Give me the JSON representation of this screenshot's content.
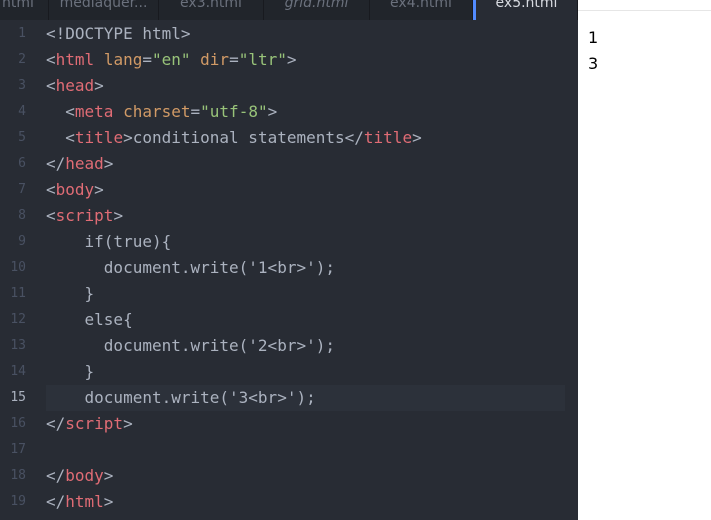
{
  "tabs": [
    {
      "label": "html",
      "italic": false,
      "active": false
    },
    {
      "label": "mediaquer...",
      "italic": false,
      "active": false
    },
    {
      "label": "ex3.html",
      "italic": false,
      "active": false
    },
    {
      "label": "grid.html",
      "italic": true,
      "active": false
    },
    {
      "label": "ex4.html",
      "italic": false,
      "active": false
    },
    {
      "label": "ex5.html",
      "italic": false,
      "active": true
    }
  ],
  "editor": {
    "current_line": "15",
    "colors": {
      "background": "#282c34",
      "tag": "#e06c75",
      "attribute": "#d19a66",
      "string": "#98c379",
      "text": "#abb2bf",
      "active_tab_accent": "#528bff"
    },
    "lines": [
      {
        "num": "1",
        "t": [
          {
            "x": "<!DOCTYPE html>"
          }
        ]
      },
      {
        "num": "2",
        "t": [
          {
            "x": "<"
          },
          {
            "x": "html",
            "c": "tag"
          },
          {
            "x": " "
          },
          {
            "x": "lang",
            "c": "attr"
          },
          {
            "x": "="
          },
          {
            "x": "\"en\"",
            "c": "str"
          },
          {
            "x": " "
          },
          {
            "x": "dir",
            "c": "attr"
          },
          {
            "x": "="
          },
          {
            "x": "\"ltr\"",
            "c": "str"
          },
          {
            "x": ">"
          }
        ]
      },
      {
        "num": "3",
        "t": [
          {
            "x": "<"
          },
          {
            "x": "head",
            "c": "tag"
          },
          {
            "x": ">"
          }
        ]
      },
      {
        "num": "4",
        "t": [
          {
            "x": "  <"
          },
          {
            "x": "meta",
            "c": "tag"
          },
          {
            "x": " "
          },
          {
            "x": "charset",
            "c": "attr"
          },
          {
            "x": "="
          },
          {
            "x": "\"utf-8\"",
            "c": "str"
          },
          {
            "x": ">"
          }
        ]
      },
      {
        "num": "5",
        "t": [
          {
            "x": "  <"
          },
          {
            "x": "title",
            "c": "tag"
          },
          {
            "x": ">conditional statements</"
          },
          {
            "x": "title",
            "c": "tag"
          },
          {
            "x": ">"
          }
        ]
      },
      {
        "num": "6",
        "t": [
          {
            "x": "</"
          },
          {
            "x": "head",
            "c": "tag"
          },
          {
            "x": ">"
          }
        ]
      },
      {
        "num": "7",
        "t": [
          {
            "x": "<"
          },
          {
            "x": "body",
            "c": "tag"
          },
          {
            "x": ">"
          }
        ]
      },
      {
        "num": "8",
        "t": [
          {
            "x": "<"
          },
          {
            "x": "script",
            "c": "tag"
          },
          {
            "x": ">"
          }
        ]
      },
      {
        "num": "9",
        "t": [
          {
            "x": "    if(true){"
          }
        ]
      },
      {
        "num": "10",
        "t": [
          {
            "x": "      document.write('1<br>');"
          }
        ]
      },
      {
        "num": "11",
        "t": [
          {
            "x": "    }"
          }
        ]
      },
      {
        "num": "12",
        "t": [
          {
            "x": "    else{"
          }
        ]
      },
      {
        "num": "13",
        "t": [
          {
            "x": "      document.write('2<br>');"
          }
        ]
      },
      {
        "num": "14",
        "t": [
          {
            "x": "    }"
          }
        ]
      },
      {
        "num": "15",
        "t": [
          {
            "x": "    document.write('3<br>');"
          }
        ]
      },
      {
        "num": "16",
        "t": [
          {
            "x": "</"
          },
          {
            "x": "script",
            "c": "tag"
          },
          {
            "x": ">"
          }
        ]
      },
      {
        "num": "17",
        "t": []
      },
      {
        "num": "18",
        "t": [
          {
            "x": "</"
          },
          {
            "x": "body",
            "c": "tag"
          },
          {
            "x": ">"
          }
        ]
      },
      {
        "num": "19",
        "t": [
          {
            "x": "</"
          },
          {
            "x": "html",
            "c": "tag"
          },
          {
            "x": ">"
          }
        ]
      }
    ]
  },
  "output": {
    "lines": [
      "1",
      "3"
    ]
  }
}
